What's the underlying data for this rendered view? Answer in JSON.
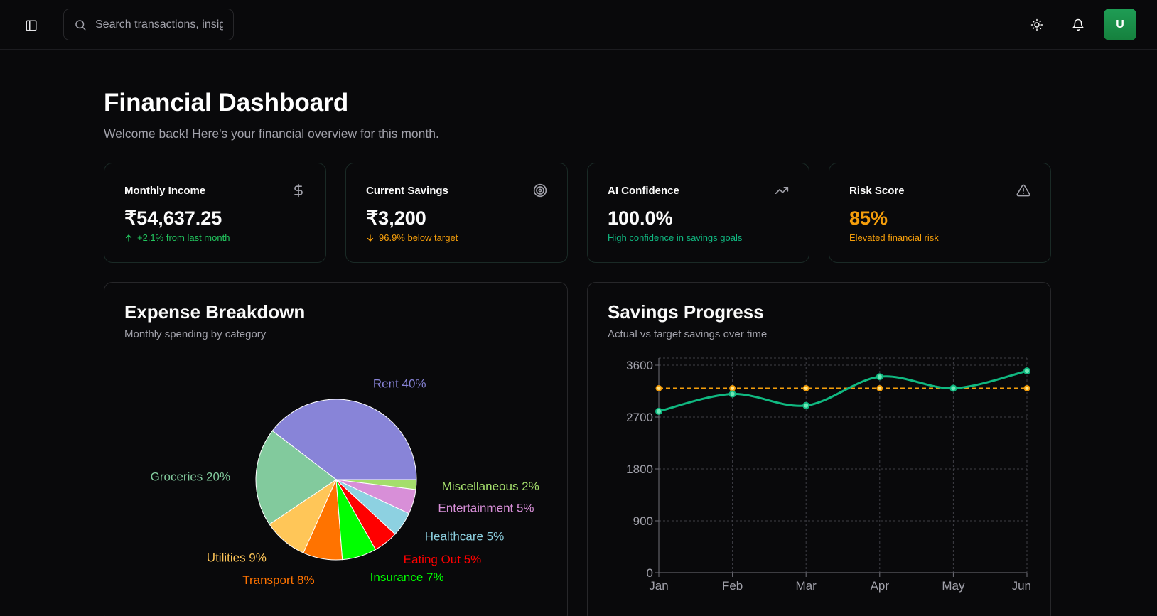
{
  "search": {
    "placeholder": "Search transactions, insights..."
  },
  "user": {
    "initial": "U"
  },
  "page": {
    "title": "Financial Dashboard",
    "subtitle": "Welcome back! Here's your financial overview for this month."
  },
  "stats": [
    {
      "label": "Monthly Income",
      "value": "₹54,637.25",
      "note": "+2.1% from last month",
      "icon": "dollar-icon",
      "color": "#22c55e",
      "arrow": "arrow-up-icon"
    },
    {
      "label": "Current Savings",
      "value": "₹3,200",
      "note": "96.9% below target",
      "icon": "target-icon",
      "color": "#f59e0b",
      "arrow": "arrow-down-icon"
    },
    {
      "label": "AI Confidence",
      "value": "100.0%",
      "note": "High confidence in savings goals",
      "icon": "trending-up-icon",
      "color": "#10b981"
    },
    {
      "label": "Risk Score",
      "value": "85%",
      "note": "Elevated financial risk",
      "icon": "alert-triangle-icon",
      "color": "#f59e0b"
    }
  ],
  "expense": {
    "title": "Expense Breakdown",
    "subtitle": "Monthly spending by category"
  },
  "savings": {
    "title": "Savings Progress",
    "subtitle": "Actual vs target savings over time"
  },
  "chart_data": [
    {
      "type": "pie",
      "slices": [
        {
          "label": "Rent",
          "value": 40,
          "color": "#8884d8"
        },
        {
          "label": "Groceries",
          "value": 20,
          "color": "#82ca9d"
        },
        {
          "label": "Utilities",
          "value": 9,
          "color": "#ffc658"
        },
        {
          "label": "Transport",
          "value": 8,
          "color": "#ff7300"
        },
        {
          "label": "Insurance",
          "value": 7,
          "color": "#00ff00"
        },
        {
          "label": "Eating Out",
          "value": 5,
          "color": "#ff0000"
        },
        {
          "label": "Healthcare",
          "value": 5,
          "color": "#8dd1e1"
        },
        {
          "label": "Entertainment",
          "value": 5,
          "color": "#d88fd8"
        },
        {
          "label": "Miscellaneous",
          "value": 2,
          "color": "#a4de6c"
        }
      ]
    },
    {
      "type": "line",
      "categories": [
        "Jan",
        "Feb",
        "Mar",
        "Apr",
        "May",
        "Jun"
      ],
      "series": [
        {
          "values": [
            2800,
            3100,
            2900,
            3400,
            3200,
            3500
          ],
          "color": "#10b981",
          "style": "solid"
        },
        {
          "values": [
            3200,
            3200,
            3200,
            3200,
            3200,
            3200
          ],
          "color": "#f59e0b",
          "style": "dashed"
        }
      ],
      "yticks": [
        0,
        900,
        1800,
        2700,
        3600
      ],
      "ylim": [
        0,
        3600
      ],
      "grid": true
    }
  ]
}
